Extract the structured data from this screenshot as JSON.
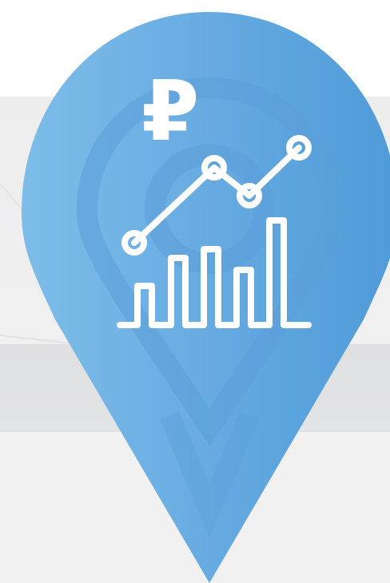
{
  "icon": {
    "pin": "map-pin-icon",
    "currency": "ruble-icon",
    "chart": "growth-chart-icon"
  },
  "currency_symbol": "₽",
  "colors": {
    "pin_light": "#7ebde9",
    "pin_dark": "#4f9bd8",
    "icon_stroke": "#ffffff",
    "background_light": "#ededee",
    "background_band": "#dfe0e2"
  }
}
